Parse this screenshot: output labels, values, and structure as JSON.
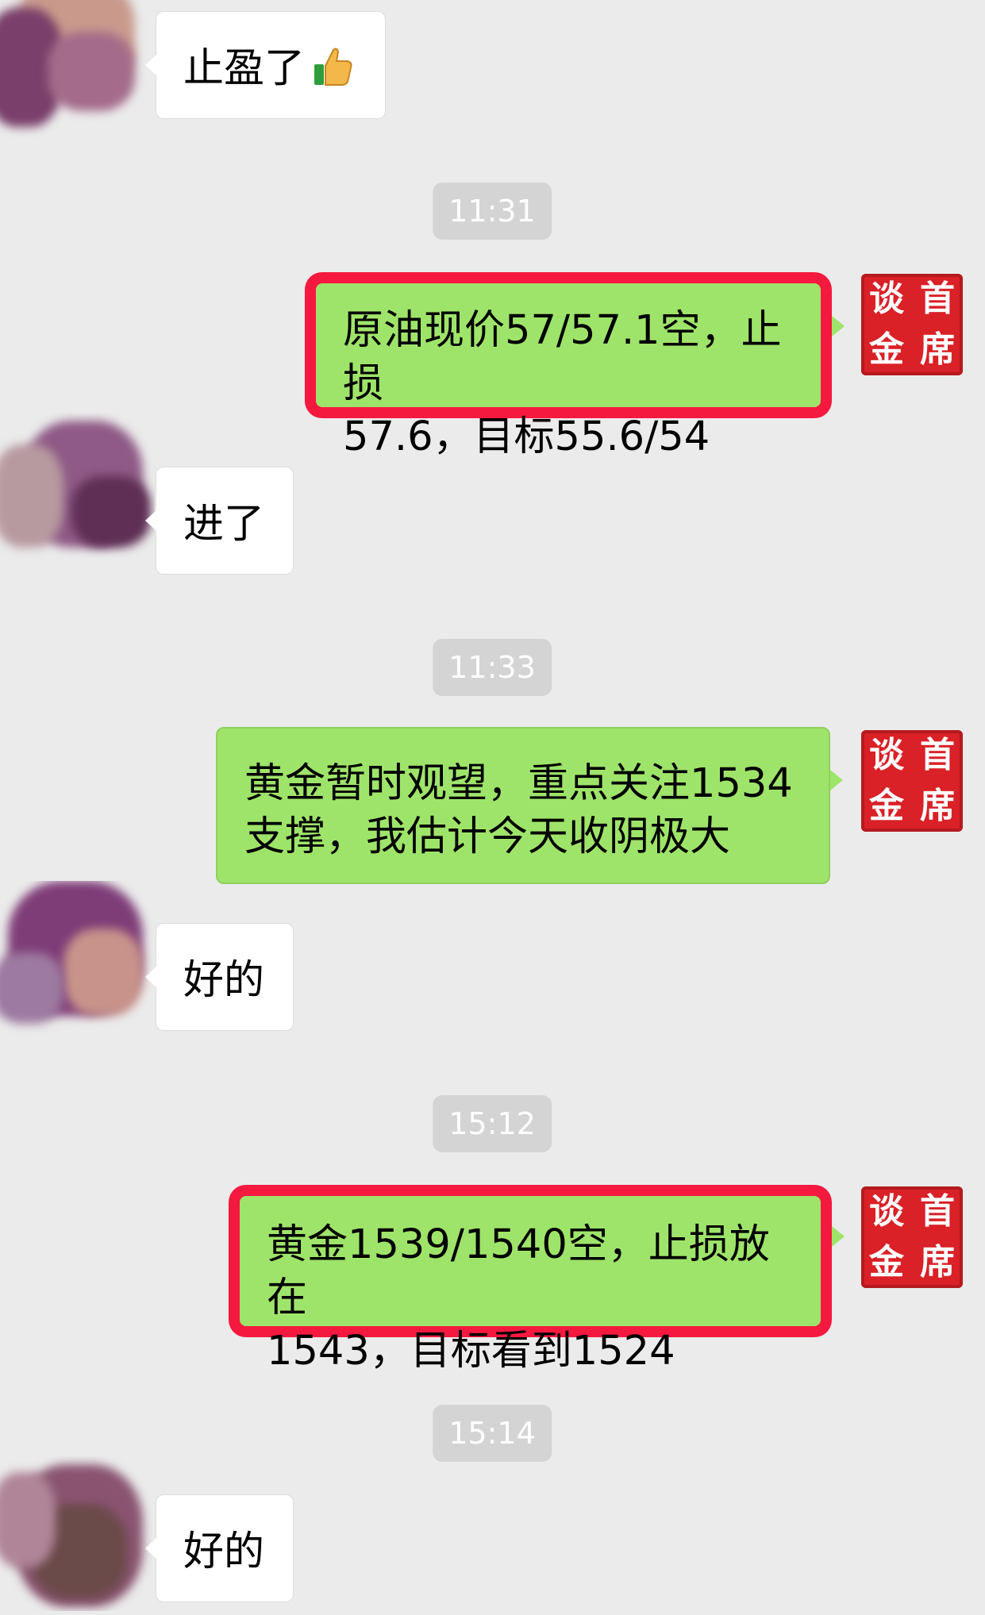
{
  "messages": [
    {
      "text": "止盈了",
      "emoji": "thumbs-up"
    },
    {
      "time": "11:31"
    },
    {
      "text": "原油现价57/57.1空，止损57.6，目标55.6/54",
      "line1": "原油现价57/57.1空，止损",
      "line2": "57.6，目标55.6/54"
    },
    {
      "text": "进了"
    },
    {
      "time": "11:33"
    },
    {
      "line1": "黄金暂时观望，重点关注1534",
      "line2": "支撑，我估计今天收阴极大"
    },
    {
      "text": "好的"
    },
    {
      "time": "15:12"
    },
    {
      "line1": "黄金1539/1540空，止损放在",
      "line2": "1543，目标看到1524"
    },
    {
      "time": "15:14"
    },
    {
      "text": "好的"
    }
  ],
  "avatar_logo": {
    "chars": [
      "谈",
      "首",
      "金",
      "席"
    ]
  },
  "colors": {
    "background": "#ebebeb",
    "outgoing_bubble": "#9fe46a",
    "incoming_bubble": "#ffffff",
    "highlight_box": "#f5193f",
    "logo_red": "#d92127"
  }
}
